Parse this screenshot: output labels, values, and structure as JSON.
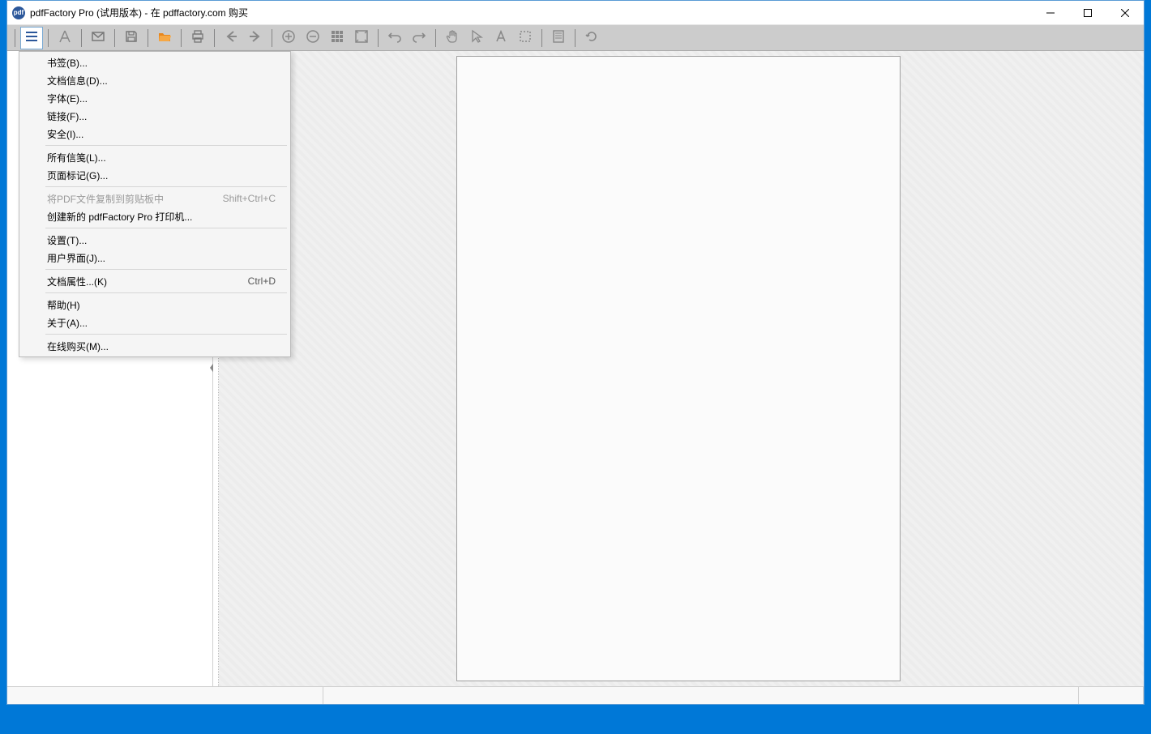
{
  "title": "pdfFactory Pro (试用版本) - 在 pdffactory.com 购买",
  "app_icon_text": "pdf",
  "menu": {
    "bookmarks": "书签(B)...",
    "doc_info": "文档信息(D)...",
    "fonts": "字体(E)...",
    "links": "链接(F)...",
    "security": "安全(I)...",
    "all_letterheads": "所有信笺(L)...",
    "page_marks": "页面标记(G)...",
    "copy_pdf_clipboard": "将PDF文件复制到剪贴板中",
    "copy_pdf_clipboard_shortcut": "Shift+Ctrl+C",
    "create_new_printer": "创建新的 pdfFactory Pro 打印机...",
    "settings": "设置(T)...",
    "user_interface": "用户界面(J)...",
    "doc_properties": "文档属性...(K)",
    "doc_properties_shortcut": "Ctrl+D",
    "help": "帮助(H)",
    "about": "关于(A)...",
    "buy_online": "在线购买(M)..."
  }
}
